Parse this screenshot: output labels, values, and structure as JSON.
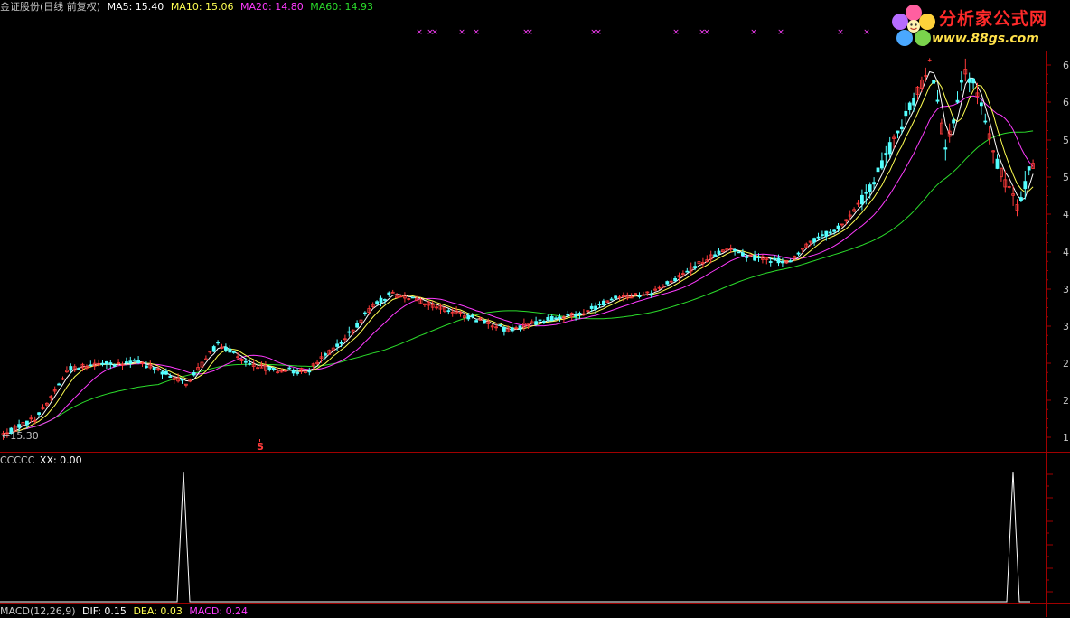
{
  "header": {
    "stock": "金证股份(日线 前复权)",
    "ma5": "MA5: 15.40",
    "ma10": "MA10: 15.06",
    "ma20": "MA20: 14.80",
    "ma60": "MA60: 14.93"
  },
  "indicator_header": {
    "name": "CCCCC",
    "xx": "XX: 0.00"
  },
  "macd_header": {
    "name": "MACD(12,26,9)",
    "dif": "DIF: 0.15",
    "dea": "DEA: 0.03",
    "macd": "MACD: 0.24"
  },
  "watermark": {
    "title": "分析家公式网",
    "url": "www.88gs.com"
  },
  "low_label": "15.30",
  "signal_label": "S",
  "colors": {
    "up": "#ff3b3b",
    "down": "#54ffff",
    "ma5": "#ffffff",
    "ma10": "#ffff52",
    "ma20": "#ff3bff",
    "ma60": "#2bdc2b",
    "axis": "#a00000",
    "marker": "#ff40ff"
  },
  "chart_data": [
    {
      "type": "candlestick",
      "title": "金证股份(日线 前复权)",
      "y_tick_labels": [
        "6",
        "6",
        "5",
        "5",
        "4",
        "4",
        "3",
        "3",
        "2",
        "2",
        "1"
      ],
      "series": [
        {
          "name": "MA5",
          "color": "#ffffff"
        },
        {
          "name": "MA10",
          "color": "#ffff52"
        },
        {
          "name": "MA20",
          "color": "#ff3bff"
        },
        {
          "name": "MA60",
          "color": "#2bdc2b"
        }
      ],
      "annotations": {
        "low_price": "15.30",
        "signal": "S",
        "marker_symbol": "×"
      }
    },
    {
      "type": "line",
      "title": "CCCCC",
      "series": [
        {
          "name": "XX",
          "last_value": 0.0,
          "spikes": 2
        }
      ]
    }
  ]
}
